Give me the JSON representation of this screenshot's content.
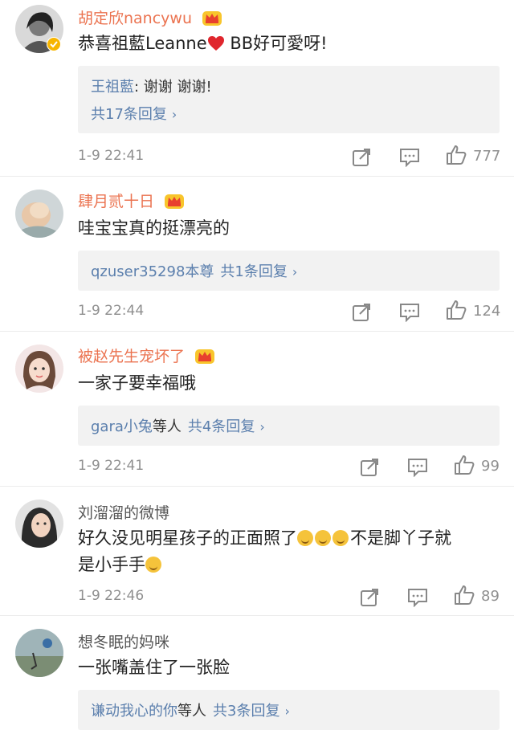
{
  "comments": [
    {
      "user": "胡定欣nancywu",
      "text": "恭喜祖藍Leanne",
      "text_after": " BB好可愛呀!",
      "reply_author": "王祖藍",
      "reply_text": ": 谢谢 谢谢!",
      "reply_count": "共17条回复",
      "time": "1-9 22:41",
      "likes": "777"
    },
    {
      "user": "肆月贰十日",
      "text": "哇宝宝真的挺漂亮的",
      "reply_users": "qzuser35298本尊",
      "reply_count": "共1条回复",
      "time": "1-9 22:44",
      "likes": "124"
    },
    {
      "user": "被赵先生宠坏了",
      "text": "一家子要幸福哦",
      "reply_users": "gara小兔",
      "reply_suffix": "等人",
      "reply_count": "共4条回复",
      "time": "1-9 22:41",
      "likes": "99"
    },
    {
      "user": "刘溜溜的微博",
      "text": "好久没见明星孩子的正面照了",
      "text_mid": "不是脚丫子就",
      "text_line2": "是小手手",
      "time": "1-9 22:46",
      "likes": "89"
    },
    {
      "user": "想冬眠的妈咪",
      "text": "一张嘴盖住了一张脸",
      "reply_users": "谦动我心的你",
      "reply_suffix": "等人",
      "reply_count": "共3条回复"
    }
  ],
  "icons": [
    "share-icon",
    "comment-icon",
    "like-icon",
    "crown-icon",
    "verified-icon",
    "heart-emoji",
    "smile-emoji",
    "laugh-emoji"
  ],
  "colors": {
    "vip_name": "#eb7350",
    "link": "#5b7fad",
    "meta": "#8f8f8f",
    "reply_bg": "#f2f2f2"
  }
}
